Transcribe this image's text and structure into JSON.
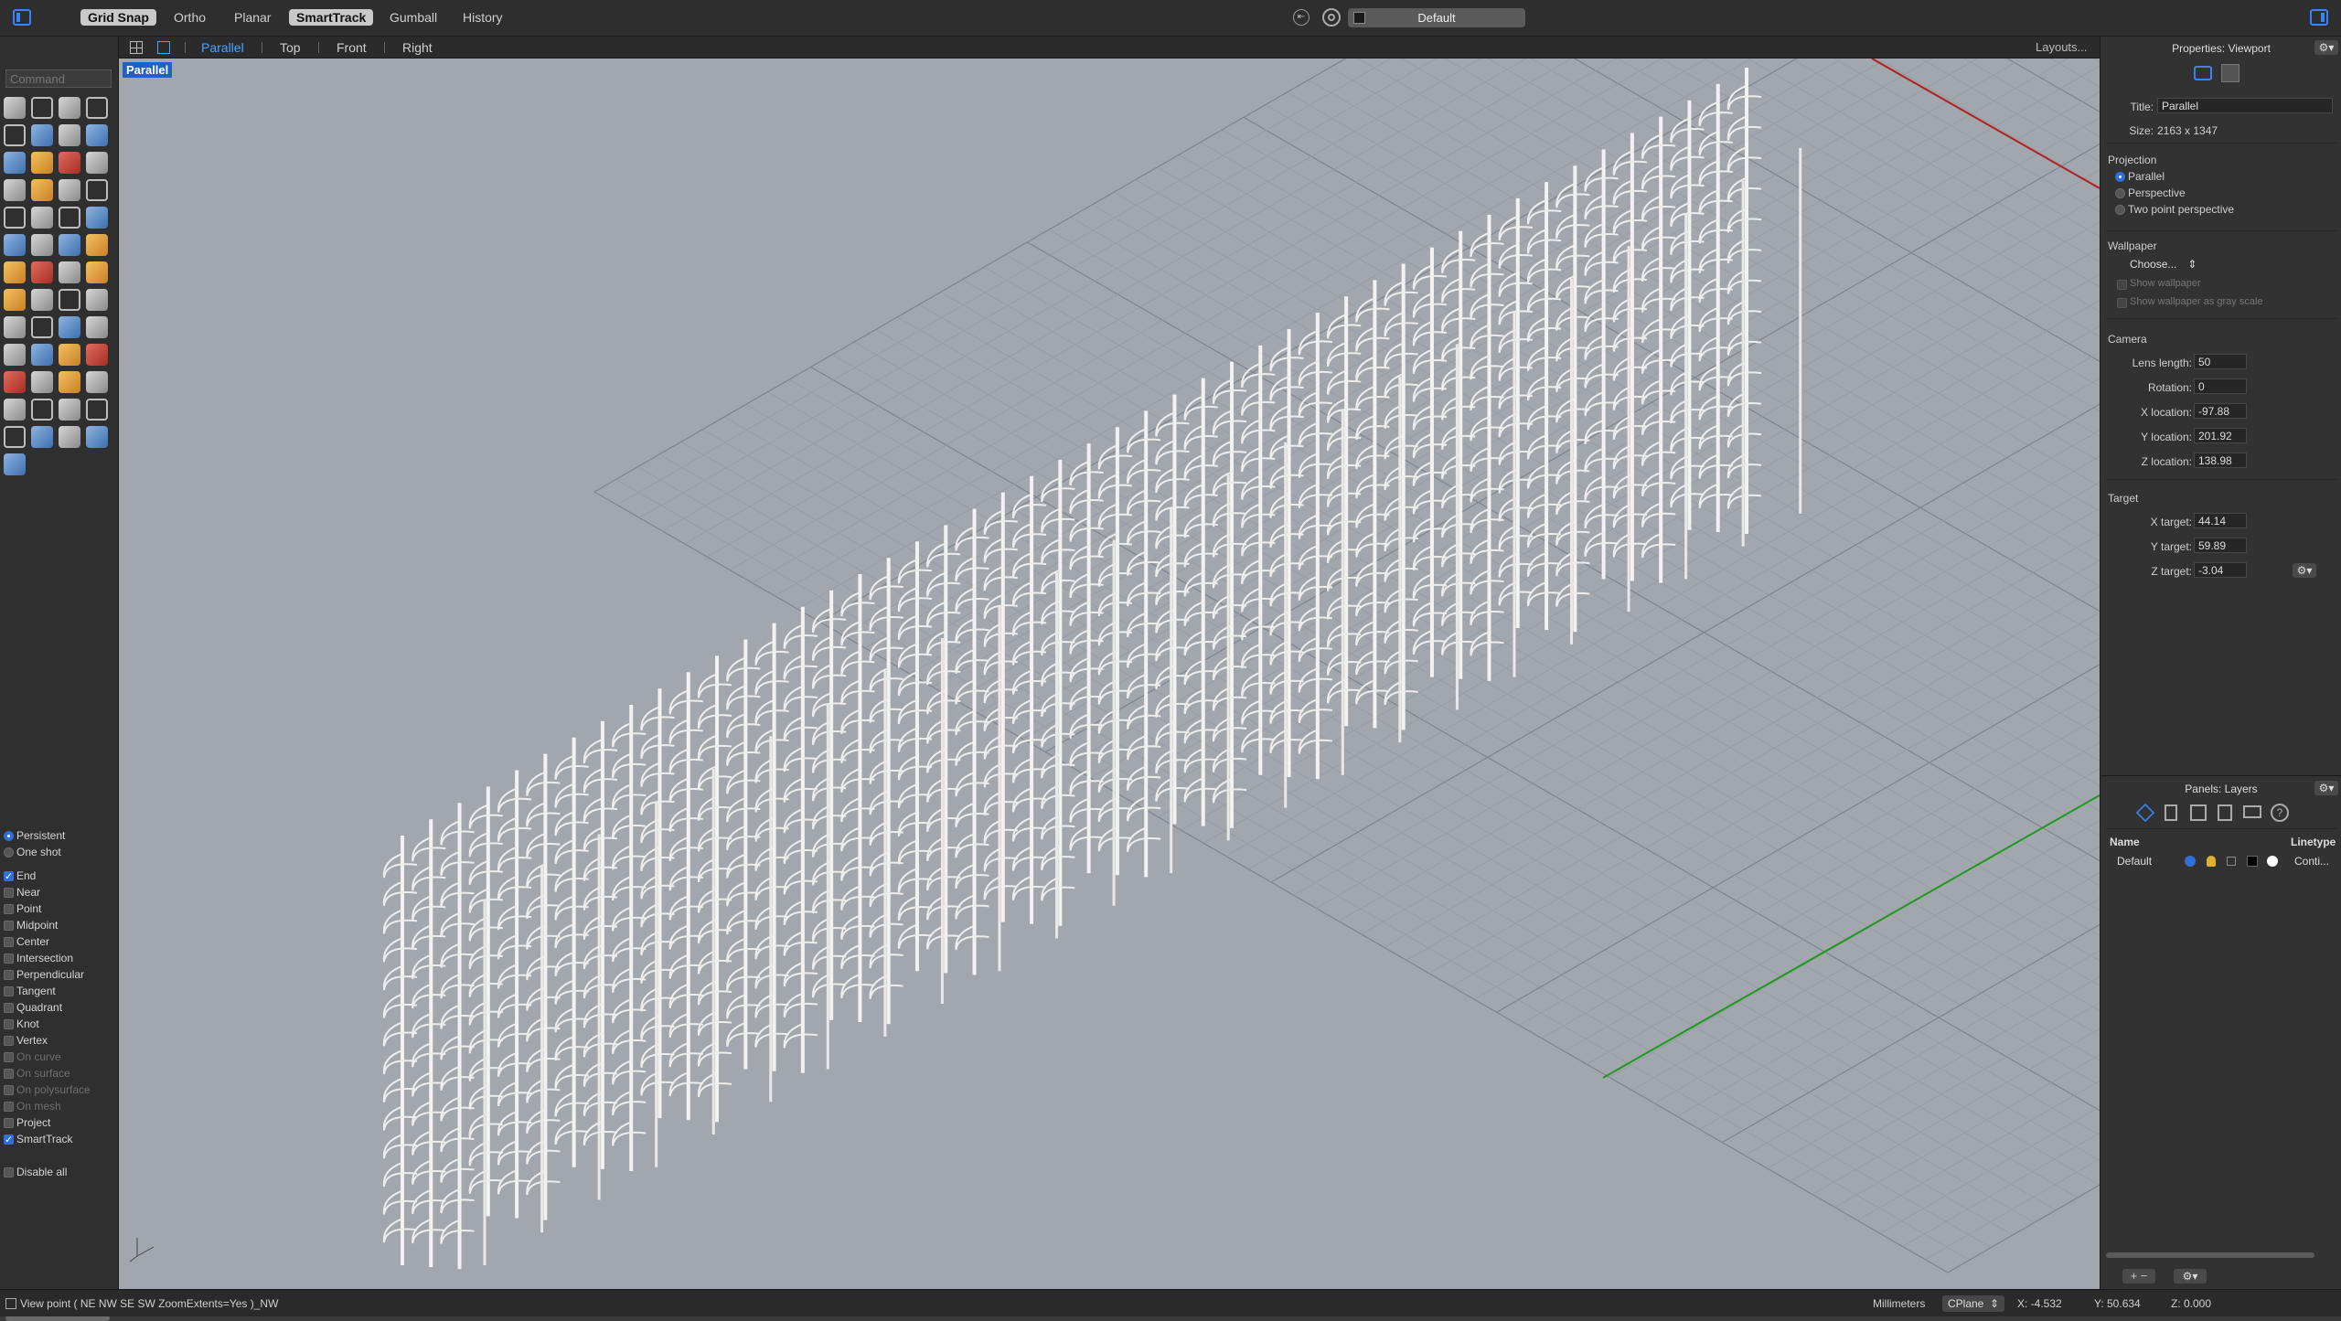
{
  "topbar": {
    "grid_snap": "Grid Snap",
    "ortho": "Ortho",
    "planar": "Planar",
    "smarttrack": "SmartTrack",
    "gumball": "Gumball",
    "history": "History",
    "layer_name": "Default"
  },
  "viewport_tabs": {
    "parallel": "Parallel",
    "top": "Top",
    "front": "Front",
    "right": "Right",
    "layouts": "Layouts..."
  },
  "command": {
    "placeholder": "Command"
  },
  "viewport": {
    "label": "Parallel"
  },
  "osnap": {
    "persistent": "Persistent",
    "one_shot": "One shot",
    "items": [
      {
        "label": "End",
        "checked": true,
        "enabled": true
      },
      {
        "label": "Near",
        "checked": false,
        "enabled": true
      },
      {
        "label": "Point",
        "checked": false,
        "enabled": true
      },
      {
        "label": "Midpoint",
        "checked": false,
        "enabled": true
      },
      {
        "label": "Center",
        "checked": false,
        "enabled": true
      },
      {
        "label": "Intersection",
        "checked": false,
        "enabled": true
      },
      {
        "label": "Perpendicular",
        "checked": false,
        "enabled": true
      },
      {
        "label": "Tangent",
        "checked": false,
        "enabled": true
      },
      {
        "label": "Quadrant",
        "checked": false,
        "enabled": true
      },
      {
        "label": "Knot",
        "checked": false,
        "enabled": true
      },
      {
        "label": "Vertex",
        "checked": false,
        "enabled": true
      },
      {
        "label": "On curve",
        "checked": false,
        "enabled": false
      },
      {
        "label": "On surface",
        "checked": false,
        "enabled": false
      },
      {
        "label": "On polysurface",
        "checked": false,
        "enabled": false
      },
      {
        "label": "On mesh",
        "checked": false,
        "enabled": false
      },
      {
        "label": "Project",
        "checked": false,
        "enabled": true
      },
      {
        "label": "SmartTrack",
        "checked": true,
        "enabled": true
      }
    ],
    "disable_all": "Disable all"
  },
  "properties": {
    "header": "Properties: Viewport",
    "title_label": "Title:",
    "title_value": "Parallel",
    "size_label": "Size:",
    "size_value": "2163 x 1347",
    "projection": "Projection",
    "proj_parallel": "Parallel",
    "proj_perspective": "Perspective",
    "proj_two_point": "Two point perspective",
    "wallpaper": "Wallpaper",
    "choose": "Choose...",
    "show_wallpaper": "Show wallpaper",
    "show_wallpaper_gray": "Show wallpaper as gray scale",
    "camera": "Camera",
    "lens_length_label": "Lens length:",
    "lens_length": "50",
    "rotation_label": "Rotation:",
    "rotation": "0",
    "x_location_label": "X location:",
    "x_location": "-97.88",
    "y_location_label": "Y location:",
    "y_location": "201.92",
    "z_location_label": "Z location:",
    "z_location": "138.98",
    "target": "Target",
    "x_target_label": "X target:",
    "x_target": "44.14",
    "y_target_label": "Y target:",
    "y_target": "59.89",
    "z_target_label": "Z target:",
    "z_target": "-3.04"
  },
  "layers": {
    "header": "Panels: Layers",
    "col_name": "Name",
    "col_linetype": "Linetype",
    "row_name": "Default",
    "row_linetype": "Conti..."
  },
  "status": {
    "prompt": "View point ( NE NW SE SW ZoomExtents=Yes )_NW",
    "units": "Millimeters",
    "cplane": "CPlane",
    "x": "X: -4.532",
    "y": "Y: 50.634",
    "z": "Z: 0.000"
  },
  "colors": {
    "accent": "#4aa3ff",
    "viewport_bg": "#a2a7ae",
    "x_axis": "#b02020",
    "y_axis": "#1e9a1e"
  }
}
